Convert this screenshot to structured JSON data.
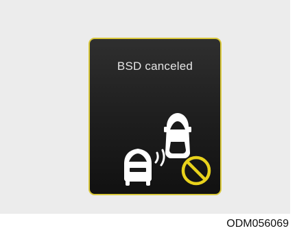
{
  "display": {
    "message": "BSD canceled",
    "frame_color": "#d9c83a",
    "warning_color": "#e8d21c",
    "vehicle_color": "#ffffff",
    "icons": [
      "rear-car-icon",
      "front-car-icon",
      "sensor-wave-icon",
      "prohibition-icon"
    ]
  },
  "figure": {
    "code": "ODM056069"
  }
}
